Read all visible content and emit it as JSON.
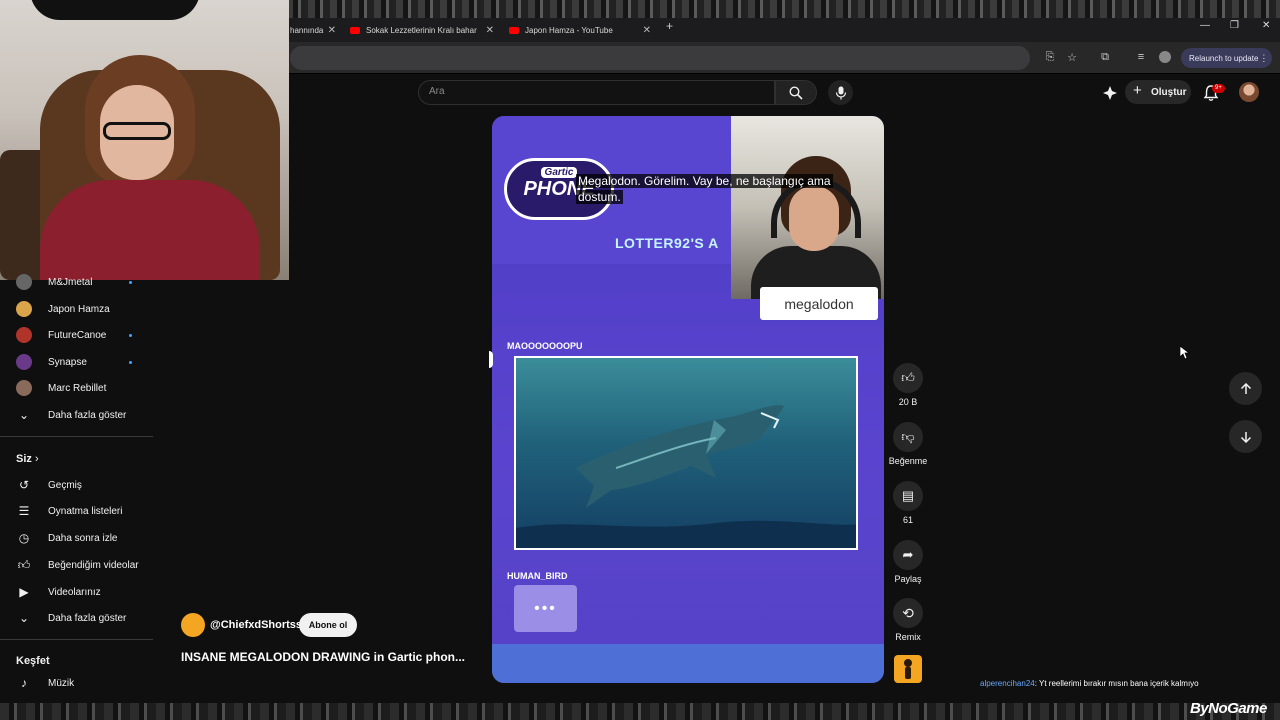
{
  "browser": {
    "tabs": [
      {
        "label": "hannında"
      },
      {
        "label": "Sokak Lezzetlerinin Kralı bahar"
      },
      {
        "label": "Japon Hamza - YouTube"
      }
    ],
    "relaunch_label": "Relaunch to update"
  },
  "search": {
    "placeholder": "Ara"
  },
  "header": {
    "create_label": "Oluştur",
    "notification_badge": "9+"
  },
  "sidebar": {
    "subscriptions": [
      {
        "label": "M&Jmetal",
        "color": "#666666"
      },
      {
        "label": "Japon Hamza",
        "color": "#d9a44a"
      },
      {
        "label": "FutureCanoe",
        "color": "#b0342a"
      },
      {
        "label": "Synapse",
        "color": "#6a3a8a"
      },
      {
        "label": "Marc Rebillet",
        "color": "#8a6a5a"
      }
    ],
    "show_more_1": "Daha fazla göster",
    "you_heading": "Siz",
    "you_items": [
      {
        "label": "Geçmiş",
        "icon": "history-icon"
      },
      {
        "label": "Oynatma listeleri",
        "icon": "playlists-icon"
      },
      {
        "label": "Daha sonra izle",
        "icon": "watch-later-icon"
      },
      {
        "label": "Beğendiğim videolar",
        "icon": "liked-videos-icon"
      },
      {
        "label": "Videolarınız",
        "icon": "your-videos-icon"
      }
    ],
    "show_more_2": "Daha fazla göster",
    "explore_heading": "Keşfet",
    "explore_items": [
      {
        "label": "Müzik",
        "icon": "music-icon"
      }
    ]
  },
  "video": {
    "logo_text": "PHONE",
    "logo_small": "Gartic",
    "banner_text": "LOTTER92'S A",
    "caption_line1": "Megalodon.  Görelim.  Vay be, ne başlangıç ama",
    "caption_line2": "dostum.",
    "answer_text": "megalodon",
    "player1": "MAOOOOOOOPU",
    "player2": "HUMAN_BIRD"
  },
  "actions": {
    "like_count": "20 B",
    "dislike_label": "Beğenme",
    "comment_count": "61",
    "share_label": "Paylaş",
    "remix_label": "Remix"
  },
  "channel": {
    "name": "@ChiefxdShortss",
    "subscribe_label": "Abone ol",
    "video_title": "INSANE MEGALODON DRAWING in Gartic phon..."
  },
  "stream_chat": {
    "user": "alperencihan24",
    "message": ": Yt reellerimi bırakır mısın bana içerik kalmıyo"
  },
  "watermark": "ByNoGame",
  "colors": {
    "youtube_red": "#ff0000",
    "accent_blue": "#3ea6ff",
    "video_purple": "#5846d1"
  }
}
